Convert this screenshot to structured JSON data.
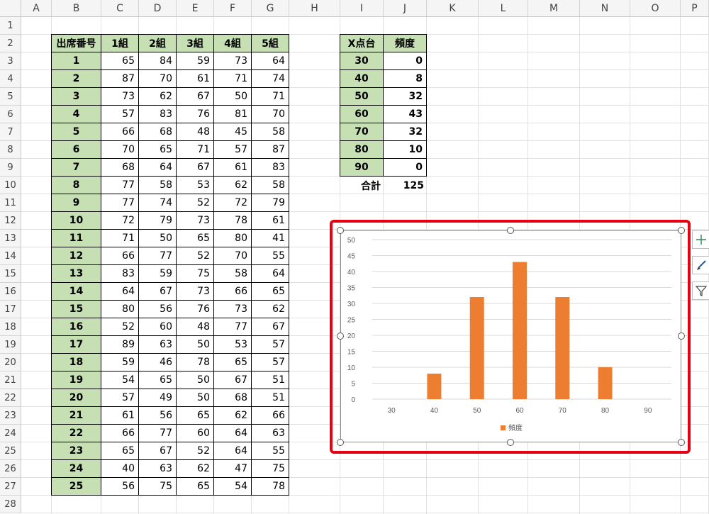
{
  "columns": [
    "A",
    "B",
    "C",
    "D",
    "E",
    "F",
    "G",
    "H",
    "I",
    "J",
    "K",
    "L",
    "M",
    "N",
    "O",
    "P"
  ],
  "rows": [
    "1",
    "2",
    "3",
    "4",
    "5",
    "6",
    "7",
    "8",
    "9",
    "10",
    "11",
    "12",
    "13",
    "14",
    "15",
    "16",
    "17",
    "18",
    "19",
    "20",
    "21",
    "22",
    "23",
    "24",
    "25",
    "26",
    "27",
    "28"
  ],
  "scores_table": {
    "headers": [
      "出席番号",
      "1組",
      "2組",
      "3組",
      "4組",
      "5組"
    ],
    "rows": [
      [
        "1",
        "65",
        "84",
        "59",
        "73",
        "64"
      ],
      [
        "2",
        "87",
        "70",
        "61",
        "71",
        "74"
      ],
      [
        "3",
        "73",
        "62",
        "67",
        "50",
        "71"
      ],
      [
        "4",
        "57",
        "83",
        "76",
        "81",
        "70"
      ],
      [
        "5",
        "66",
        "68",
        "48",
        "45",
        "58"
      ],
      [
        "6",
        "70",
        "65",
        "71",
        "57",
        "87"
      ],
      [
        "7",
        "68",
        "64",
        "67",
        "61",
        "83"
      ],
      [
        "8",
        "77",
        "58",
        "53",
        "62",
        "58"
      ],
      [
        "9",
        "77",
        "74",
        "52",
        "72",
        "79"
      ],
      [
        "10",
        "72",
        "79",
        "73",
        "78",
        "61"
      ],
      [
        "11",
        "71",
        "50",
        "65",
        "80",
        "41"
      ],
      [
        "12",
        "66",
        "77",
        "52",
        "70",
        "55"
      ],
      [
        "13",
        "83",
        "59",
        "75",
        "58",
        "64"
      ],
      [
        "14",
        "64",
        "67",
        "73",
        "66",
        "65"
      ],
      [
        "15",
        "80",
        "56",
        "76",
        "73",
        "62"
      ],
      [
        "16",
        "52",
        "60",
        "48",
        "77",
        "67"
      ],
      [
        "17",
        "89",
        "63",
        "50",
        "53",
        "57"
      ],
      [
        "18",
        "59",
        "46",
        "78",
        "65",
        "57"
      ],
      [
        "19",
        "54",
        "65",
        "50",
        "67",
        "51"
      ],
      [
        "20",
        "57",
        "49",
        "50",
        "68",
        "51"
      ],
      [
        "21",
        "61",
        "56",
        "65",
        "62",
        "66"
      ],
      [
        "22",
        "66",
        "77",
        "60",
        "64",
        "63"
      ],
      [
        "23",
        "65",
        "67",
        "52",
        "64",
        "55"
      ],
      [
        "24",
        "40",
        "63",
        "62",
        "47",
        "75"
      ],
      [
        "25",
        "56",
        "75",
        "65",
        "54",
        "78"
      ]
    ]
  },
  "freq_table": {
    "headers": [
      "X点台",
      "頻度"
    ],
    "rows": [
      [
        "30",
        "0"
      ],
      [
        "40",
        "8"
      ],
      [
        "50",
        "32"
      ],
      [
        "60",
        "43"
      ],
      [
        "70",
        "32"
      ],
      [
        "80",
        "10"
      ],
      [
        "90",
        "0"
      ]
    ],
    "total_label": "合計",
    "total_value": "125"
  },
  "chart_data": {
    "type": "bar",
    "categories": [
      "30",
      "40",
      "50",
      "60",
      "70",
      "80",
      "90"
    ],
    "series": [
      {
        "name": "頻度",
        "values": [
          0,
          8,
          32,
          43,
          32,
          10,
          0
        ],
        "color": "#ed7d31"
      }
    ],
    "ylim": [
      0,
      50
    ],
    "yticks": [
      0,
      5,
      10,
      15,
      20,
      25,
      30,
      35,
      40,
      45,
      50
    ],
    "grid": true,
    "legend": "bottom"
  },
  "side_buttons": [
    {
      "icon": "plus-icon"
    },
    {
      "icon": "brush-icon"
    },
    {
      "icon": "filter-icon"
    }
  ],
  "colors": {
    "header_fill": "#c6e0b4",
    "bar": "#ed7d31",
    "selection": "#e60012"
  }
}
